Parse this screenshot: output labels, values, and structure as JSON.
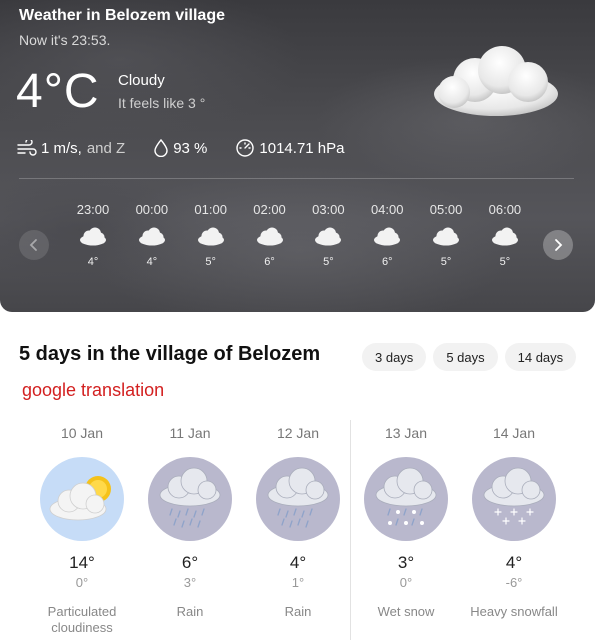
{
  "current": {
    "title": "Weather in Belozem village",
    "time_text": "Now it's 23:53.",
    "temperature": "4°C",
    "condition": "Cloudy",
    "feels_like": "It feels like 3 °",
    "wind_value": "1 m/s,",
    "wind_dir": "and Z",
    "humidity": "93 %",
    "pressure": "1014.71 hPa"
  },
  "hourly": [
    {
      "time": "23:00",
      "temp": "4°",
      "icon": "cloud-icon"
    },
    {
      "time": "00:00",
      "temp": "4°",
      "icon": "cloud-icon"
    },
    {
      "time": "01:00",
      "temp": "5°",
      "icon": "cloud-icon"
    },
    {
      "time": "02:00",
      "temp": "6°",
      "icon": "cloud-icon"
    },
    {
      "time": "03:00",
      "temp": "5°",
      "icon": "cloud-icon"
    },
    {
      "time": "04:00",
      "temp": "6°",
      "icon": "cloud-icon"
    },
    {
      "time": "05:00",
      "temp": "5°",
      "icon": "cloud-icon"
    },
    {
      "time": "06:00",
      "temp": "5°",
      "icon": "cloud-icon"
    }
  ],
  "forecast": {
    "title": "5 days in the village of Belozem",
    "tabs": [
      "3 days",
      "5 days",
      "14 days"
    ],
    "translation_note": "google translation",
    "days": [
      {
        "date": "10 Jan",
        "max": "14°",
        "min": "0°",
        "desc": "Particulated cloudiness",
        "icon": "partly-cloudy-icon"
      },
      {
        "date": "11 Jan",
        "max": "6°",
        "min": "3°",
        "desc": "Rain",
        "icon": "rain-icon"
      },
      {
        "date": "12 Jan",
        "max": "4°",
        "min": "1°",
        "desc": "Rain",
        "icon": "rain-icon"
      },
      {
        "date": "13 Jan",
        "max": "3°",
        "min": "0°",
        "desc": "Wet snow",
        "icon": "wet-snow-icon"
      },
      {
        "date": "14 Jan",
        "max": "4°",
        "min": "-6°",
        "desc": "Heavy snowfall",
        "icon": "snowfall-icon"
      }
    ]
  },
  "colors": {
    "accent_red": "#d32020",
    "card_dark": "#4c4c50",
    "icon_bg_grey": "#b9b8cd",
    "icon_bg_blue": "#c6dcf7"
  }
}
